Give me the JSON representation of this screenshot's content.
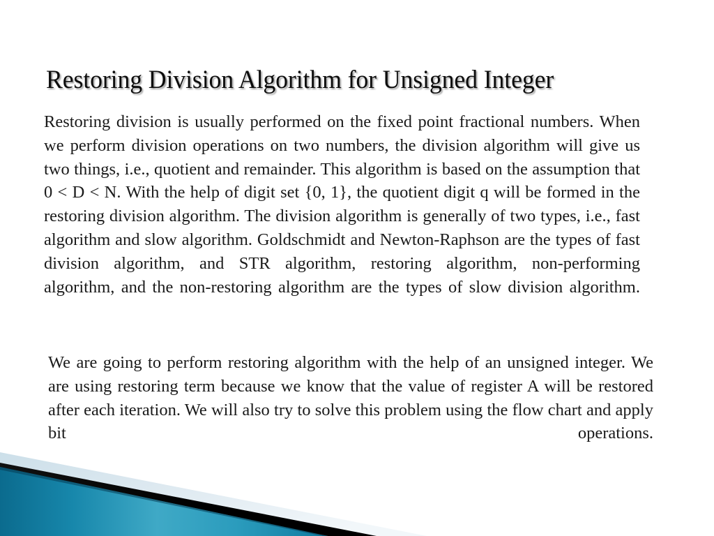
{
  "slide": {
    "title": "Restoring Division Algorithm for Unsigned Integer",
    "paragraph_1": "Restoring division is usually performed on the fixed point fractional numbers. When we perform division operations on two numbers, the division algorithm will give us two things, i.e., quotient and remainder. This algorithm is based on the assumption that 0 < D < N. With the help of digit set {0, 1}, the quotient digit q will be formed in the restoring division algorithm. The division algorithm is generally of two types, i.e., fast algorithm and slow algorithm. Goldschmidt and Newton-Raphson are the types of fast division algorithm, and STR algorithm, restoring algorithm, non-performing algorithm, and the non-restoring algorithm are the types of slow division algorithm.",
    "paragraph_2": "We are going to perform restoring algorithm with the help of an unsigned integer. We are using restoring term because we know that the value of register A will be restored after each iteration. We will also try to solve this problem using the flow chart and apply bit operations."
  },
  "theme": {
    "background_color": "#ffffff",
    "title_color": "#0d0d0d",
    "body_color": "#1a1a1a",
    "accent_teal_dark": "#0c6f92",
    "accent_teal_mid": "#2a9cbe",
    "accent_teal_light": "#49b3cf",
    "accent_black": "#000000",
    "accent_pale_blue": "#dde9f0"
  },
  "decoration": {
    "name": "bottom-left-diagonal-banner",
    "shapes": [
      "teal-wedge",
      "black-diagonal-stripe",
      "pale-blue-diagonal-band"
    ]
  }
}
